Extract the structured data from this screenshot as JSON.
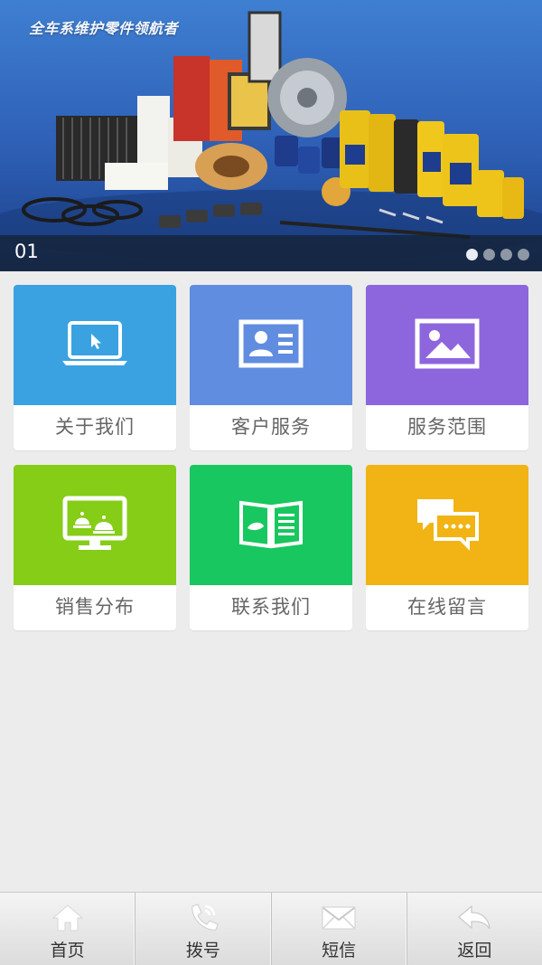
{
  "banner": {
    "slogan": "全车系维护零件领航者",
    "slide_number": "01",
    "slide_count": 4,
    "active_slide": 1
  },
  "tiles": [
    {
      "label": "关于我们",
      "icon": "laptop-icon",
      "color": "#3aa2e0"
    },
    {
      "label": "客户服务",
      "icon": "contact-card-icon",
      "color": "#618de0"
    },
    {
      "label": "服务范围",
      "icon": "picture-icon",
      "color": "#8d66de"
    },
    {
      "label": "销售分布",
      "icon": "monitor-icon",
      "color": "#85cd17"
    },
    {
      "label": "联系我们",
      "icon": "book-icon",
      "color": "#18c75f"
    },
    {
      "label": "在线留言",
      "icon": "chat-bubbles-icon",
      "color": "#f1b414"
    }
  ],
  "tabbar": {
    "items": [
      {
        "label": "首页",
        "icon": "home-icon"
      },
      {
        "label": "拨号",
        "icon": "phone-icon"
      },
      {
        "label": "短信",
        "icon": "envelope-icon"
      },
      {
        "label": "返回",
        "icon": "back-arrow-icon"
      }
    ]
  }
}
